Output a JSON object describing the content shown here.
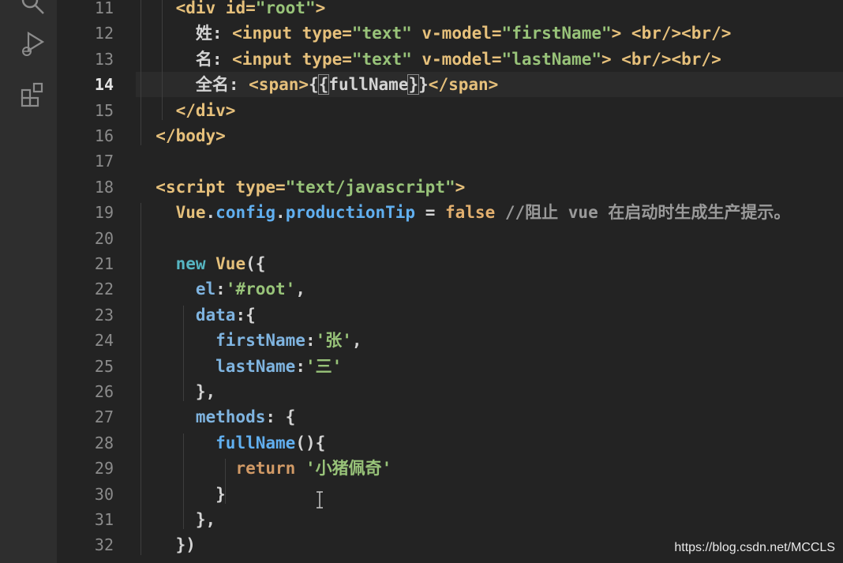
{
  "activity_bar": {
    "icons": [
      "search-icon",
      "run-debug-icon",
      "extensions-icon"
    ]
  },
  "editor": {
    "active_line": 14,
    "line_numbers": [
      "11",
      "12",
      "13",
      "14",
      "15",
      "16",
      "17",
      "18",
      "19",
      "20",
      "21",
      "22",
      "23",
      "24",
      "25",
      "26",
      "27",
      "28",
      "29",
      "30",
      "31",
      "32"
    ],
    "lines": [
      [
        {
          "t": "    ",
          "c": "t-txt"
        },
        {
          "t": "<div ",
          "c": "t-tag"
        },
        {
          "t": "id=",
          "c": "t-attr"
        },
        {
          "t": "\"root\"",
          "c": "t-str"
        },
        {
          "t": ">",
          "c": "t-tag"
        }
      ],
      [
        {
          "t": "      姓: ",
          "c": "t-txt"
        },
        {
          "t": "<input ",
          "c": "t-tag"
        },
        {
          "t": "type=",
          "c": "t-attr"
        },
        {
          "t": "\"text\"",
          "c": "t-str"
        },
        {
          "t": " v-model=",
          "c": "t-attr"
        },
        {
          "t": "\"firstName\"",
          "c": "t-str"
        },
        {
          "t": "> ",
          "c": "t-tag"
        },
        {
          "t": "<br/><br/>",
          "c": "t-tag"
        }
      ],
      [
        {
          "t": "      名: ",
          "c": "t-txt"
        },
        {
          "t": "<input ",
          "c": "t-tag"
        },
        {
          "t": "type=",
          "c": "t-attr"
        },
        {
          "t": "\"text\"",
          "c": "t-str"
        },
        {
          "t": " v-model=",
          "c": "t-attr"
        },
        {
          "t": "\"lastName\"",
          "c": "t-str"
        },
        {
          "t": "> ",
          "c": "t-tag"
        },
        {
          "t": "<br/><br/>",
          "c": "t-tag"
        }
      ],
      [
        {
          "t": "      全名: ",
          "c": "t-txt"
        },
        {
          "t": "<span>",
          "c": "t-tag"
        },
        {
          "t": "{",
          "c": "t-punc"
        },
        {
          "t": "{",
          "c": "t-punc bracket-hl"
        },
        {
          "t": "fullName",
          "c": "t-txt"
        },
        {
          "t": "}",
          "c": "t-punc bracket-hl"
        },
        {
          "t": "}",
          "c": "t-punc"
        },
        {
          "t": "</span>",
          "c": "t-tag"
        }
      ],
      [
        {
          "t": "    ",
          "c": "t-txt"
        },
        {
          "t": "</div>",
          "c": "t-tag"
        }
      ],
      [
        {
          "t": "  ",
          "c": "t-txt"
        },
        {
          "t": "</body>",
          "c": "t-tag"
        }
      ],
      [
        {
          "t": "",
          "c": "t-txt"
        }
      ],
      [
        {
          "t": "  ",
          "c": "t-txt"
        },
        {
          "t": "<script ",
          "c": "t-tag"
        },
        {
          "t": "type=",
          "c": "t-attr"
        },
        {
          "t": "\"text/javascript\"",
          "c": "t-str"
        },
        {
          "t": ">",
          "c": "t-tag"
        }
      ],
      [
        {
          "t": "    ",
          "c": "t-txt"
        },
        {
          "t": "Vue",
          "c": "t-kw"
        },
        {
          "t": ".",
          "c": "t-punc"
        },
        {
          "t": "config",
          "c": "t-prop"
        },
        {
          "t": ".",
          "c": "t-punc"
        },
        {
          "t": "productionTip",
          "c": "t-prop"
        },
        {
          "t": " = ",
          "c": "t-punc"
        },
        {
          "t": "false",
          "c": "t-bool"
        },
        {
          "t": " //阻止 vue 在启动时生成生产提示。",
          "c": "t-comment"
        }
      ],
      [
        {
          "t": "",
          "c": "t-txt"
        }
      ],
      [
        {
          "t": "    ",
          "c": "t-txt"
        },
        {
          "t": "new ",
          "c": "t-obj"
        },
        {
          "t": "Vue",
          "c": "t-kw"
        },
        {
          "t": "({",
          "c": "t-punc"
        }
      ],
      [
        {
          "t": "      ",
          "c": "t-txt"
        },
        {
          "t": "el",
          "c": "t-key"
        },
        {
          "t": ":",
          "c": "t-punc"
        },
        {
          "t": "'#root'",
          "c": "t-str"
        },
        {
          "t": ",",
          "c": "t-punc"
        }
      ],
      [
        {
          "t": "      ",
          "c": "t-txt"
        },
        {
          "t": "data",
          "c": "t-key"
        },
        {
          "t": ":{",
          "c": "t-punc"
        }
      ],
      [
        {
          "t": "        ",
          "c": "t-txt"
        },
        {
          "t": "firstName",
          "c": "t-key"
        },
        {
          "t": ":",
          "c": "t-punc"
        },
        {
          "t": "'张'",
          "c": "t-str"
        },
        {
          "t": ",",
          "c": "t-punc"
        }
      ],
      [
        {
          "t": "        ",
          "c": "t-txt"
        },
        {
          "t": "lastName",
          "c": "t-key"
        },
        {
          "t": ":",
          "c": "t-punc"
        },
        {
          "t": "'三'",
          "c": "t-str"
        }
      ],
      [
        {
          "t": "      ",
          "c": "t-txt"
        },
        {
          "t": "},",
          "c": "t-punc"
        }
      ],
      [
        {
          "t": "      ",
          "c": "t-txt"
        },
        {
          "t": "methods",
          "c": "t-key"
        },
        {
          "t": ": {",
          "c": "t-punc"
        }
      ],
      [
        {
          "t": "        ",
          "c": "t-txt"
        },
        {
          "t": "fullName",
          "c": "t-fn"
        },
        {
          "t": "(){",
          "c": "t-punc"
        }
      ],
      [
        {
          "t": "          ",
          "c": "t-txt"
        },
        {
          "t": "return ",
          "c": "t-kw2"
        },
        {
          "t": "'小猪佩奇'",
          "c": "t-str"
        }
      ],
      [
        {
          "t": "        ",
          "c": "t-txt"
        },
        {
          "t": "}",
          "c": "t-punc"
        }
      ],
      [
        {
          "t": "      ",
          "c": "t-txt"
        },
        {
          "t": "},",
          "c": "t-punc"
        }
      ],
      [
        {
          "t": "    ",
          "c": "t-txt"
        },
        {
          "t": "})",
          "c": "t-punc"
        }
      ]
    ]
  },
  "watermark": "https://blog.csdn.net/MCCLS"
}
